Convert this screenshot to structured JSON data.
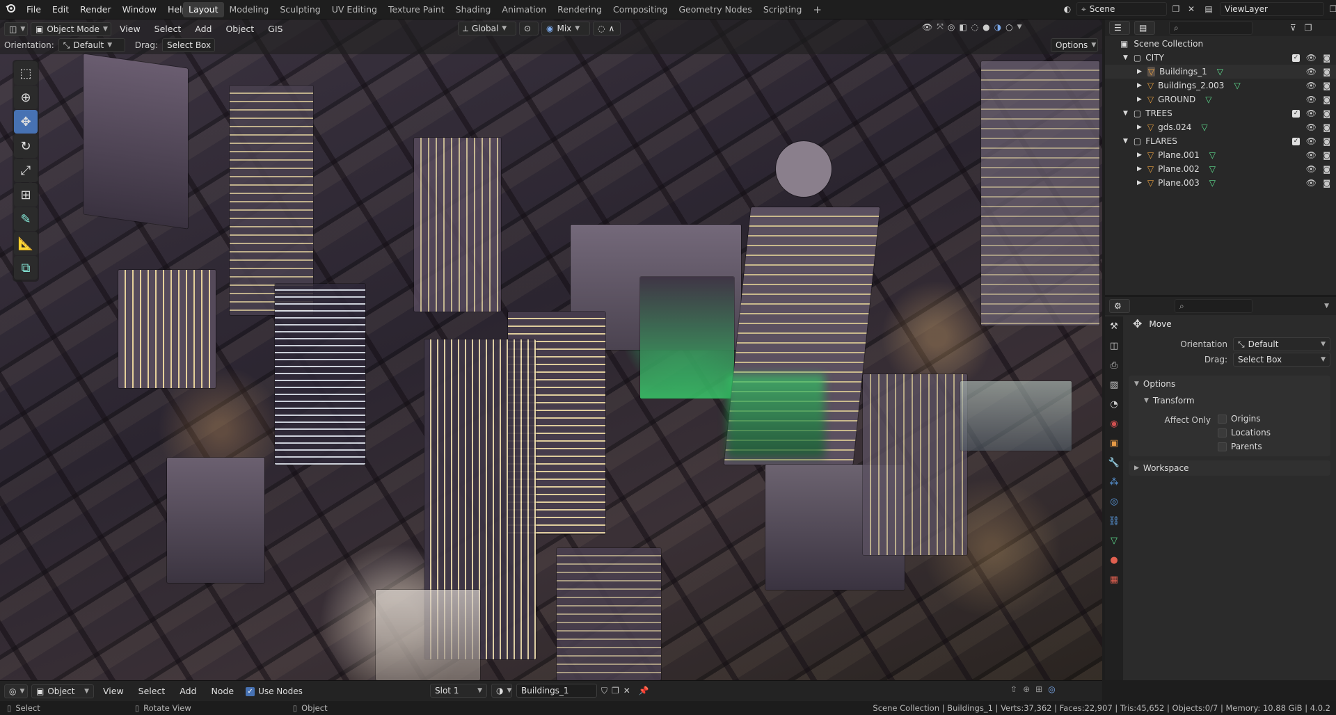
{
  "menubar": {
    "logo_icon": "blender-logo-icon",
    "items": [
      "File",
      "Edit",
      "Render",
      "Window",
      "Help"
    ],
    "workspaces": [
      "Layout",
      "Modeling",
      "Sculpting",
      "UV Editing",
      "Texture Paint",
      "Shading",
      "Animation",
      "Rendering",
      "Compositing",
      "Geometry Nodes",
      "Scripting"
    ],
    "active_workspace": "Layout",
    "add_tab": "+",
    "scene": "Scene",
    "view_layer": "ViewLayer"
  },
  "viewport_header": {
    "mode": "Object Mode",
    "menus": [
      "View",
      "Select",
      "Add",
      "Object",
      "GIS"
    ],
    "transform_orientation": "Global",
    "pivot": "Mix",
    "orientation_label": "Orientation:",
    "orientation_value": "Default",
    "drag_label": "Drag:",
    "drag_value": "Select Box",
    "options": "Options"
  },
  "toolbar": [
    "select-box",
    "cursor",
    "move",
    "rotate",
    "scale",
    "transform",
    "annotate",
    "measure",
    "add-cube"
  ],
  "active_tool": "move",
  "outliner": {
    "search_placeholder": "",
    "root": "Scene Collection",
    "rows": [
      {
        "name": "CITY",
        "type": "collection",
        "level": 1,
        "checked": true
      },
      {
        "name": "Buildings_1",
        "type": "mesh",
        "level": 2
      },
      {
        "name": "Buildings_2.003",
        "type": "mesh",
        "level": 2
      },
      {
        "name": "GROUND",
        "type": "mesh",
        "level": 2
      },
      {
        "name": "TREES",
        "type": "collection",
        "level": 1,
        "checked": true
      },
      {
        "name": "gds.024",
        "type": "mesh",
        "level": 2
      },
      {
        "name": "FLARES",
        "type": "collection",
        "level": 1,
        "checked": true
      },
      {
        "name": "Plane.001",
        "type": "mesh",
        "level": 2
      },
      {
        "name": "Plane.002",
        "type": "mesh",
        "level": 2
      },
      {
        "name": "Plane.003",
        "type": "mesh",
        "level": 2
      }
    ]
  },
  "properties": {
    "tool_name": "Move",
    "orientation_label": "Orientation",
    "orientation_value": "Default",
    "drag_label": "Drag:",
    "drag_value": "Select Box",
    "options_panel": "Options",
    "transform_sub": "Transform",
    "affect_only_label": "Affect Only",
    "affect_items": [
      "Origins",
      "Locations",
      "Parents"
    ],
    "workspace_panel": "Workspace"
  },
  "bottom": {
    "editor": "Object",
    "menus": [
      "View",
      "Select",
      "Add",
      "Node"
    ],
    "use_nodes_label": "Use Nodes",
    "use_nodes": true,
    "slot": "Slot 1",
    "material": "Buildings_1"
  },
  "status": {
    "left": [
      "Select",
      "Rotate View",
      "Object"
    ],
    "right": "Scene Collection | Buildings_1 | Verts:37,362 | Faces:22,907 | Tris:45,652 | Objects:0/7 | Memory: 10.88 GiB | 4.0.2"
  },
  "colors": {
    "accent": "#4772b3",
    "mesh_icon": "#e89a45",
    "data_icon": "#5fe090",
    "bg": "#1d1d1d"
  }
}
